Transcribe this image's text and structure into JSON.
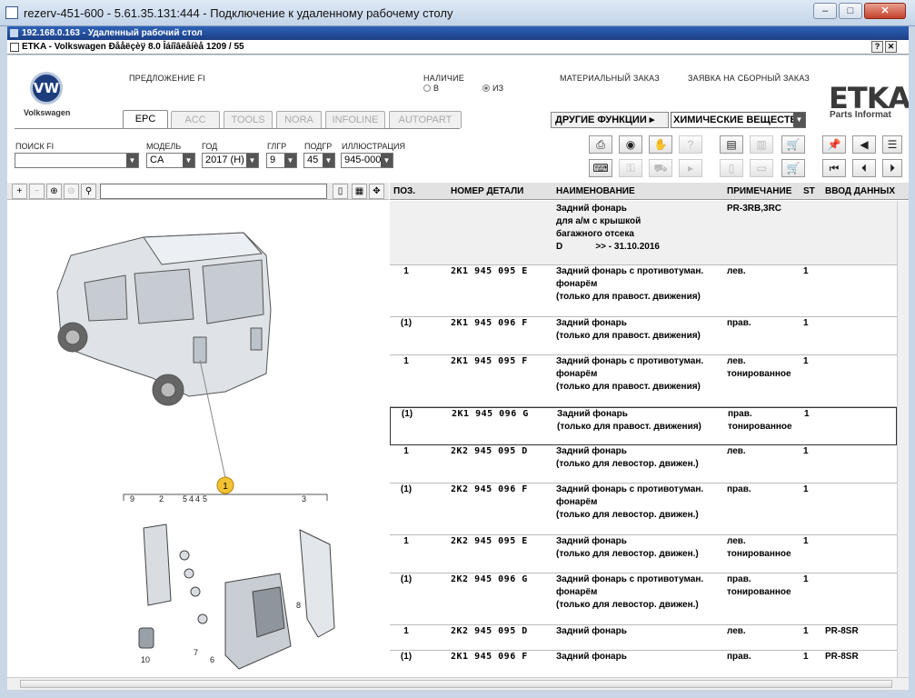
{
  "window": {
    "title": "rezerv-451-600 - 5.61.35.131:444 - Подключение к удаленному рабочему столу"
  },
  "rdp": {
    "title": "192.168.0.163 - Удаленный рабочий стол"
  },
  "etka_window": {
    "title": "ETKA - Volkswagen Ðååëçèÿ 8.0 Îáíîâëåíèå 1209 / 55"
  },
  "brand": {
    "vw_label": "Volkswagen",
    "etka_logo": "ETKA",
    "etka_sub": "Parts Informat"
  },
  "header": {
    "proposal": "ПРЕДЛОЖЕНИЕ FI",
    "availability": "НАЛИЧИЕ",
    "radio_b": "В",
    "radio_iz": "ИЗ",
    "material_order": "МАТЕРИАЛЬНЫЙ ЗАКАЗ",
    "assembly_order": "ЗАЯВКА НА СБОРНЫЙ ЗАКАЗ"
  },
  "tabs": [
    "EPC",
    "ACC",
    "TOOLS",
    "NORA",
    "INFOLINE",
    "AUTOPART"
  ],
  "functions": {
    "button": "ДРУГИЕ ФУНКЦИИ",
    "select": "ХИМИЧЕСКИЕ ВЕЩЕСТВА"
  },
  "filters": {
    "search_label": "ПОИСК FI",
    "search_value": "",
    "model_label": "МОДЕЛЬ",
    "model_value": "CA",
    "year_label": "ГОД",
    "year_value": "2017 (H)",
    "glgr_label": "ГЛГР",
    "glgr_value": "9",
    "podgr_label": "ПОДГР",
    "podgr_value": "45",
    "ill_label": "ИЛЛЮСТРАЦИЯ",
    "ill_value": "945-000"
  },
  "grid": {
    "headers": {
      "pos": "ПОЗ.",
      "part": "НОМЕР ДЕТАЛИ",
      "name": "НАИМЕНОВАНИЕ",
      "note": "ПРИМЕЧАНИЕ",
      "st": "ST",
      "input": "ВВОД ДАННЫХ"
    },
    "intro": {
      "name": "Задний фонарь\nдля а/м с крышкой\nбагажного отсека\nD             >> - 31.10.2016",
      "note": "PR-3RB,3RC"
    },
    "rows": [
      {
        "pos": "1",
        "part": "2K1 945 095 E",
        "name": "Задний фонарь с противотуман.\nфонарём\n(только для правост. движения)",
        "note": "лев.",
        "st": "1",
        "input": ""
      },
      {
        "pos": "(1)",
        "part": "2K1 945 096 F",
        "name": "Задний фонарь\n(только для правост. движения)",
        "note": "прав.",
        "st": "1",
        "input": ""
      },
      {
        "pos": "1",
        "part": "2K1 945 095 F",
        "name": "Задний фонарь с противотуман.\nфонарём\n(только для правост. движения)",
        "note": "лев.\nтонированное",
        "st": "1",
        "input": ""
      },
      {
        "pos": "(1)",
        "part": "2K1 945 096 G",
        "name": "Задний фонарь\n(только для правост. движения)",
        "note": "прав.\nтонированное",
        "st": "1",
        "input": ""
      },
      {
        "pos": "1",
        "part": "2K2 945 095 D",
        "name": "Задний фонарь\n(только для левостор. движен.)",
        "note": "лев.",
        "st": "1",
        "input": ""
      },
      {
        "pos": "(1)",
        "part": "2K2 945 096 F",
        "name": "Задний фонарь с противотуман.\nфонарём\n(только для левостор. движен.)",
        "note": "прав.",
        "st": "1",
        "input": ""
      },
      {
        "pos": "1",
        "part": "2K2 945 095 E",
        "name": "Задний фонарь\n(только для левостор. движен.)",
        "note": "лев.\nтонированное",
        "st": "1",
        "input": ""
      },
      {
        "pos": "(1)",
        "part": "2K2 945 096 G",
        "name": "Задний фонарь с противотуман.\nфонарём\n(только для левостор. движен.)",
        "note": "прав.\nтонированное",
        "st": "1",
        "input": ""
      },
      {
        "pos": "1",
        "part": "2K2 945 095 D",
        "name": "Задний фонарь",
        "note": "лев.",
        "st": "1",
        "input": "PR-8SR"
      },
      {
        "pos": "(1)",
        "part": "2K1 945 096 F",
        "name": "Задний фонарь",
        "note": "прав.",
        "st": "1",
        "input": "PR-8SR"
      }
    ]
  },
  "illustration": {
    "callout": "1",
    "labels": [
      "9",
      "2",
      "5",
      "4",
      "4",
      "5",
      "3",
      "8",
      "10",
      "7",
      "6"
    ]
  }
}
